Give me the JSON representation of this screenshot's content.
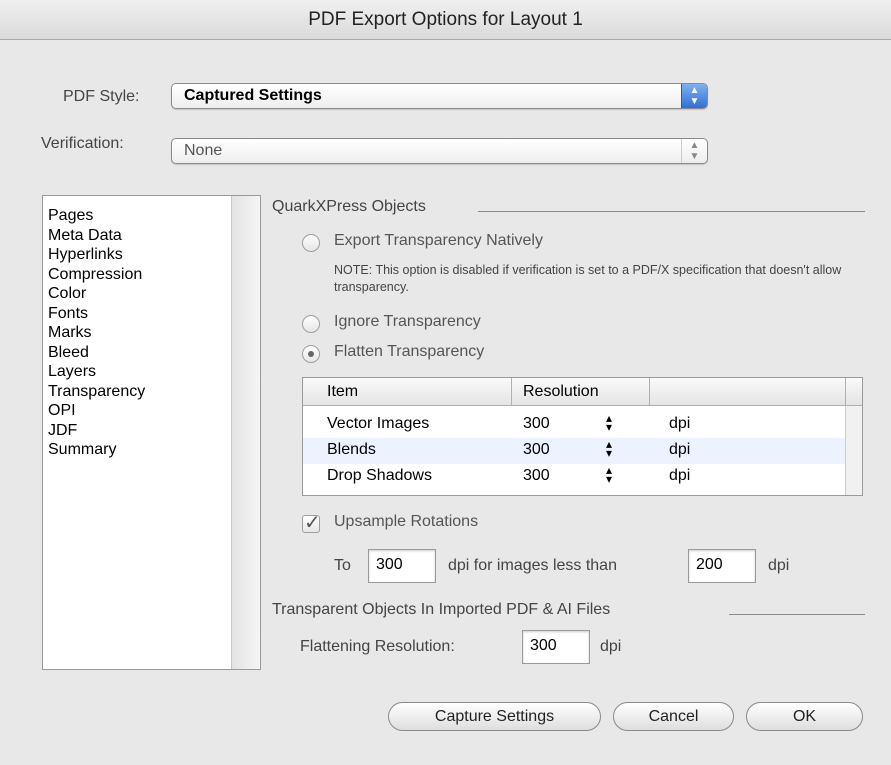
{
  "window": {
    "title": "PDF Export Options for Layout 1"
  },
  "pdf_style": {
    "label": "PDF Style:",
    "value": "Captured Settings"
  },
  "verification": {
    "label": "Verification:",
    "value": "None"
  },
  "sidebar": {
    "items": [
      {
        "label": "Pages"
      },
      {
        "label": "Meta Data"
      },
      {
        "label": "Hyperlinks"
      },
      {
        "label": "Compression"
      },
      {
        "label": "Color"
      },
      {
        "label": "Fonts"
      },
      {
        "label": "Marks"
      },
      {
        "label": "Bleed"
      },
      {
        "label": "Layers"
      },
      {
        "label": "Transparency"
      },
      {
        "label": "OPI"
      },
      {
        "label": "JDF"
      },
      {
        "label": "Summary"
      }
    ]
  },
  "quark_objects": {
    "title": "QuarkXPress Objects",
    "export_natively": {
      "label": "Export Transparency Natively",
      "selected": false
    },
    "note": "NOTE: This option is disabled if verification is set to a PDF/X specification that doesn't allow transparency.",
    "ignore": {
      "label": "Ignore Transparency",
      "selected": false
    },
    "flatten": {
      "label": "Flatten Transparency",
      "selected": true
    }
  },
  "table": {
    "headers": {
      "item": "Item",
      "resolution": "Resolution"
    },
    "rows": [
      {
        "item": "Vector Images",
        "resolution": "300",
        "unit": "dpi"
      },
      {
        "item": "Blends",
        "resolution": "300",
        "unit": "dpi"
      },
      {
        "item": "Drop Shadows",
        "resolution": "300",
        "unit": "dpi"
      }
    ]
  },
  "upsample": {
    "label": "Upsample Rotations",
    "checked": true,
    "to_label": "To",
    "to_value": "300",
    "middle_text": "dpi for images less than",
    "less_than_value": "200",
    "unit": "dpi"
  },
  "imported": {
    "title": "Transparent Objects In Imported PDF & AI Files",
    "flattening_label": "Flattening Resolution:",
    "flattening_value": "300",
    "unit": "dpi"
  },
  "buttons": {
    "capture": "Capture Settings",
    "cancel": "Cancel",
    "ok": "OK"
  },
  "colors": {
    "window_bg": "#e8e8e8",
    "popup_accent": "#2f6fd6",
    "row_highlight": "#edf3fe"
  }
}
